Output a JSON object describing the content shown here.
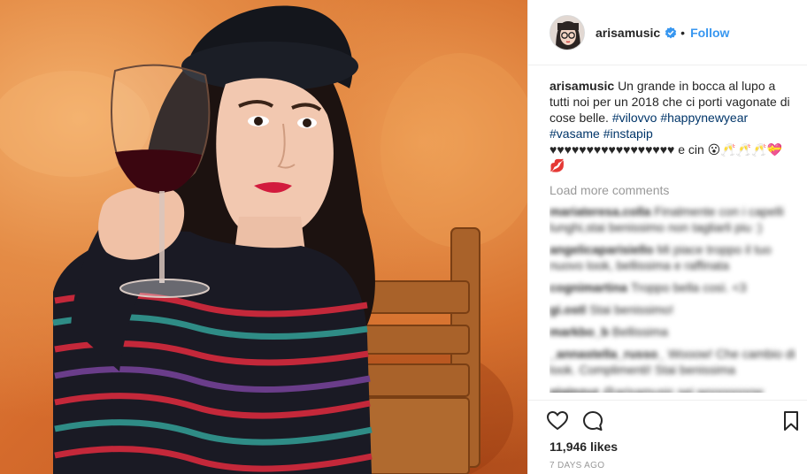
{
  "post": {
    "username": "arisamusic",
    "follow_label": "Follow",
    "separator": "•"
  },
  "caption": {
    "username": "arisamusic",
    "text": "Un grande in bocca al lupo a tutti noi per un 2018 che ci porti vagonate di cose belle.",
    "hashtags": [
      "#vilovvo",
      "#happynewyear",
      "#vasame",
      "#instapip"
    ],
    "emoji_line": "♥♥♥♥♥♥♥♥♥♥♥♥♥♥♥♥♥ e cin 😮🥂🥂🥂💝💋"
  },
  "comments": {
    "load_more": "Load more comments",
    "items": [
      {
        "user": "mariateresa.colla",
        "text": "Finalmente con i capelli lunghi,stai benissimo non tagliarli piu :)"
      },
      {
        "user": "angelicaparisiello",
        "text": "Mi piace troppo il tuo nuovo look, bellissima e raffinata"
      },
      {
        "user": "cognimartina",
        "text": "Troppo bella così. <3"
      },
      {
        "user": "gi.ostl",
        "text": "Stai benissimo!"
      },
      {
        "user": "markbo_b",
        "text": "Bellissima"
      },
      {
        "user": "_annastella_russo_",
        "text": "Wooow! Che cambio di look. Complimenti! Stai benissima"
      },
      {
        "user": "giginzuz",
        "text": "@arisamusic sei wooooooow"
      }
    ]
  },
  "actions": {
    "likes": "11,946 likes",
    "age": "7 DAYS AGO"
  },
  "colors": {
    "accent": "#3897f0",
    "hashtag": "#003569",
    "muted": "#999999",
    "text": "#262626"
  },
  "icons": [
    "verified-badge-icon",
    "heart-icon",
    "comment-icon",
    "bookmark-icon"
  ]
}
